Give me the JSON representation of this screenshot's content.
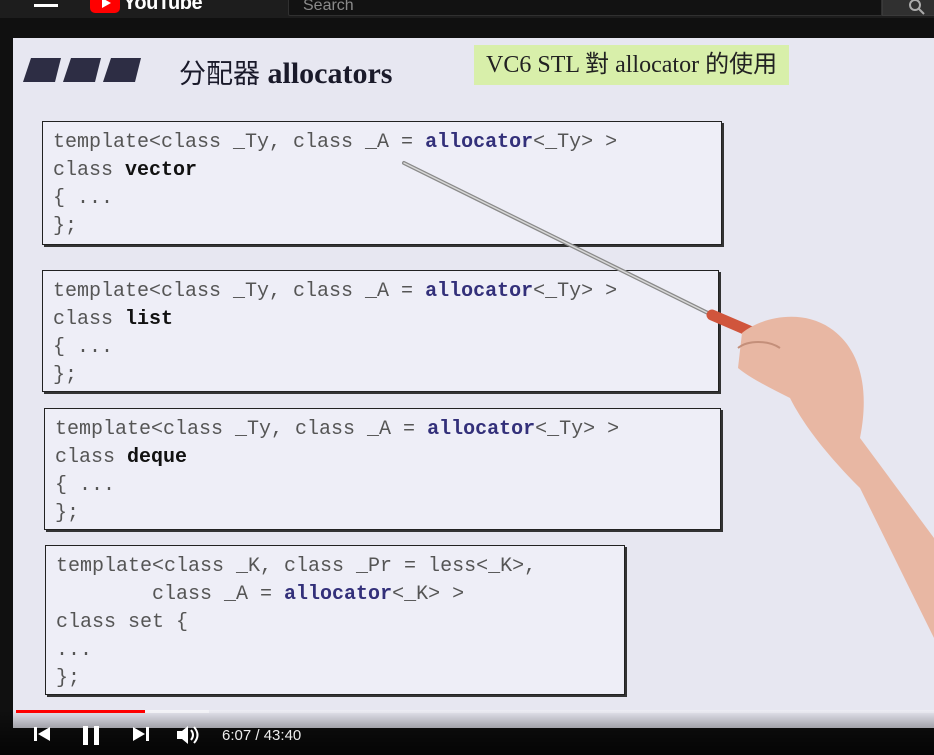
{
  "header": {
    "logo_text": "YouTube",
    "search_placeholder": "Search"
  },
  "slide": {
    "title_zh": "分配器",
    "title_en": "allocators",
    "badge": "VC6 STL 對 allocator 的使用",
    "code_blocks": [
      {
        "lines": [
          [
            "template<class _Ty, class _A = ",
            {
              "kw": "allocator"
            },
            "<_Ty> >"
          ],
          [
            "class ",
            {
              "cls": "vector"
            }
          ],
          [
            "{ ..."
          ],
          [
            "};"
          ]
        ]
      },
      {
        "lines": [
          [
            "template<class _Ty, class _A = ",
            {
              "kw": "allocator"
            },
            "<_Ty> >"
          ],
          [
            "class ",
            {
              "cls": "list"
            }
          ],
          [
            "{ ..."
          ],
          [
            "};"
          ]
        ]
      },
      {
        "lines": [
          [
            "template<class _Ty, class _A = ",
            {
              "kw": "allocator"
            },
            "<_Ty> >"
          ],
          [
            "class ",
            {
              "cls": "deque"
            }
          ],
          [
            "{ ..."
          ],
          [
            "};"
          ]
        ]
      },
      {
        "lines": [
          [
            "template<class _K, class _Pr = less<_K>,"
          ],
          [
            "        class _A = ",
            {
              "kw": "allocator"
            },
            "<_K> >"
          ],
          [
            "class set {"
          ],
          [
            "..."
          ],
          [
            "};"
          ]
        ]
      }
    ]
  },
  "player": {
    "current_time": "6:07",
    "separator": " / ",
    "duration": "43:40",
    "played_fraction": 0.14,
    "buffered_fraction": 0.21
  },
  "colors": {
    "brand_red": "#ff0000",
    "slide_bg": "#e7e7f1",
    "badge_bg": "#d8efaa",
    "keyword": "#33307a"
  },
  "icons": [
    "menu-icon",
    "youtube-logo-icon",
    "search-icon",
    "previous-icon",
    "pause-icon",
    "next-icon",
    "volume-icon"
  ]
}
